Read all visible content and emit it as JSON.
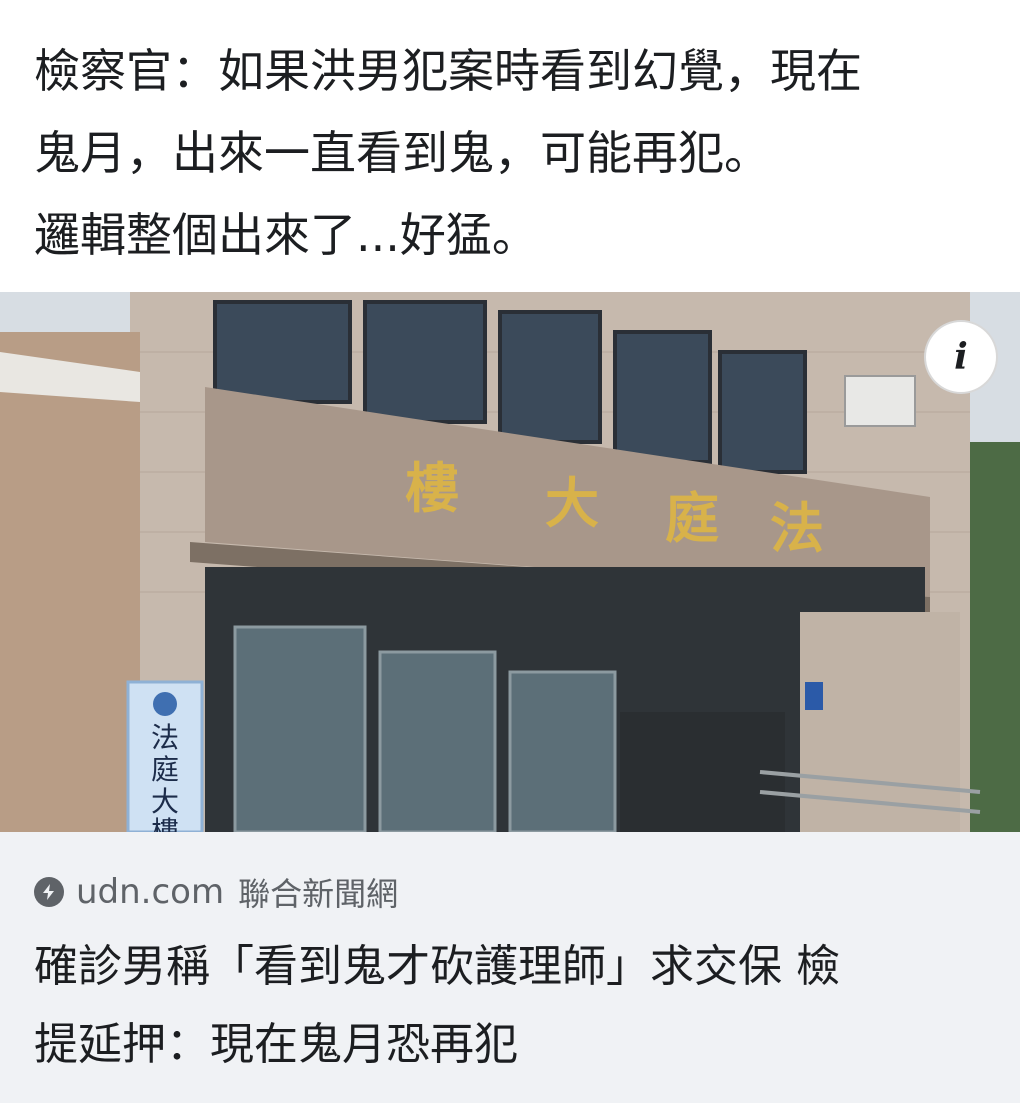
{
  "post": {
    "lines": [
      "檢察官：如果洪男犯案時看到幻覺，現在",
      "鬼月，出來一直看到鬼，可能再犯。",
      "邏輯整個出來了...好猛。"
    ]
  },
  "image": {
    "sign_chars": [
      "樓",
      "大",
      "庭",
      "法"
    ],
    "side_sign_chars": [
      "法",
      "庭",
      "大",
      "樓"
    ],
    "info_button_label": "i",
    "info_icon": "info-icon"
  },
  "link": {
    "icon": "lightning-bolt-icon",
    "domain": "udn.com",
    "source_name": "聯合新聞網",
    "title_lines": [
      "確診男稱「看到鬼才砍護理師」求交保 檢",
      "提延押：現在鬼月恐再犯"
    ]
  },
  "colors": {
    "text": "#1c1e21",
    "meta": "#5f6368",
    "preview_bg": "#f0f2f5",
    "sign_gold": "#d8b24a"
  }
}
